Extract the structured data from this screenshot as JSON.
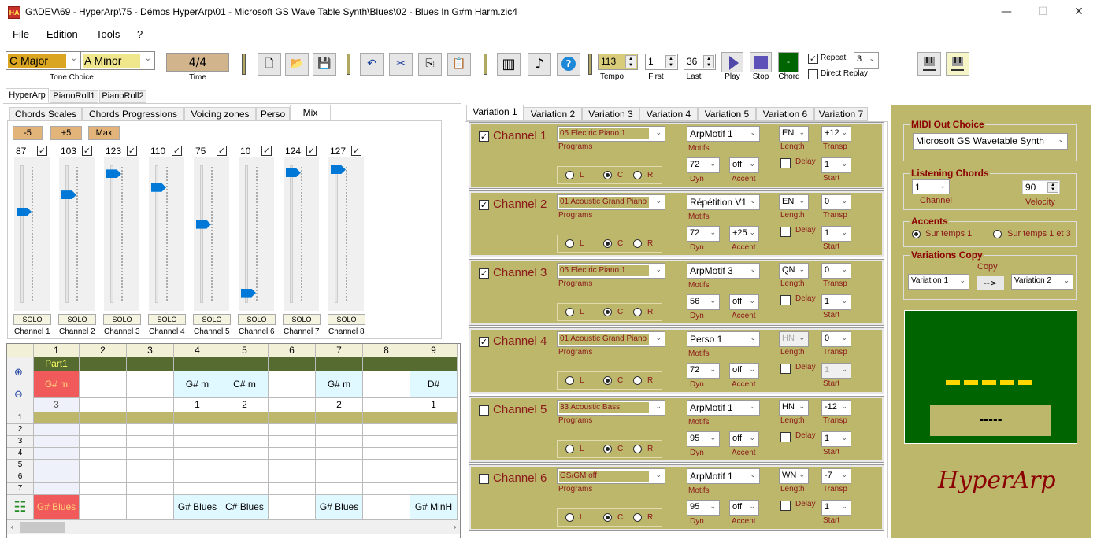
{
  "window": {
    "title": "G:\\DEV\\69 - HyperArp\\75 - Démos HyperArp\\01  - Microsoft GS Wave Table Synth\\Blues\\02 - Blues In G#m Harm.zic4",
    "app_icon": "HA",
    "controls": {
      "minimize": "—",
      "maximize": "☐",
      "close": "✕"
    }
  },
  "menu": [
    "File",
    "Edition",
    "Tools",
    "?"
  ],
  "toolbar": {
    "tone_major": "C Major",
    "tone_minor": "A Minor",
    "tone_label": "Tone Choice",
    "time_value": "4/4",
    "time_label": "Time",
    "icons": {
      "new": "🗋",
      "open": "📂",
      "save": "💾",
      "undo": "↶",
      "cut": "✂",
      "copy": "⎘",
      "paste": "📋",
      "book": "▥",
      "note": "♪",
      "help": "?"
    },
    "tempo": "113",
    "tempo_label": "Tempo",
    "first": "1",
    "first_label": "First",
    "last": "36",
    "last_label": "Last",
    "play_label": "Play",
    "stop_label": "Stop",
    "chord_value": "-",
    "chord_label": "Chord",
    "repeat_label": "Repeat",
    "repeat_checked": true,
    "repeat_count": "3",
    "direct_replay_label": "Direct Replay",
    "direct_replay_checked": false
  },
  "main_tabs": [
    "HyperArp",
    "PianoRoll1",
    "PianoRoll2"
  ],
  "sub_tabs": [
    "Chords Scales",
    "Chords Progressions",
    "Voicing zones",
    "Perso",
    "Mix"
  ],
  "mix": {
    "buttons": [
      "-5",
      "+5",
      "Max"
    ],
    "solo_label": "SOLO",
    "max_volume": 127,
    "channels": [
      {
        "label": "Channel 1",
        "volume": 87,
        "enabled": true
      },
      {
        "label": "Channel 2",
        "volume": 103,
        "enabled": true
      },
      {
        "label": "Channel 3",
        "volume": 123,
        "enabled": true
      },
      {
        "label": "Channel 4",
        "volume": 110,
        "enabled": true
      },
      {
        "label": "Channel 5",
        "volume": 75,
        "enabled": true
      },
      {
        "label": "Channel 6",
        "volume": 10,
        "enabled": true
      },
      {
        "label": "Channel 7",
        "volume": 124,
        "enabled": true
      },
      {
        "label": "Channel 8",
        "volume": 127,
        "enabled": true
      }
    ]
  },
  "grid": {
    "columns": [
      "1",
      "2",
      "3",
      "4",
      "5",
      "6",
      "7",
      "8",
      "9"
    ],
    "part_label": "Part1",
    "chords": [
      "G# m",
      "",
      "",
      "G# m",
      "C# m",
      "",
      "G# m",
      "",
      "D#"
    ],
    "counts": [
      "3",
      "",
      "",
      "1",
      "2",
      "",
      "2",
      "",
      "1"
    ],
    "row_numbers": [
      "1",
      "2",
      "3",
      "4",
      "5",
      "6",
      "7"
    ],
    "scales": [
      "G# Blues",
      "",
      "",
      "G# Blues",
      "C# Blues",
      "",
      "G# Blues",
      "",
      "G# MinH"
    ]
  },
  "variation_tabs": [
    "Variation 1",
    "Variation 2",
    "Variation 3",
    "Variation 4",
    "Variation 5",
    "Variation 6",
    "Variation 7"
  ],
  "channel_labels": {
    "programs": "Programs",
    "motifs": "Motifs",
    "length": "Length",
    "transp": "Transp",
    "dyn": "Dyn",
    "accent": "Accent",
    "delay": "Delay",
    "start": "Start",
    "pan": [
      "L",
      "C",
      "R"
    ]
  },
  "variation_channels": [
    {
      "name": "Channel 1",
      "enabled": true,
      "program": "05 Electric Piano 1",
      "motif": "ArpMotif 1",
      "length": "EN",
      "transp": "+12",
      "dyn": "72",
      "accent": "off",
      "delay": false,
      "start": "1",
      "pan": "C"
    },
    {
      "name": "Channel 2",
      "enabled": true,
      "program": "01 Acoustic Grand Piano",
      "motif": "Répétition V1",
      "length": "EN",
      "transp": "0",
      "dyn": "72",
      "accent": "+25",
      "delay": false,
      "start": "1",
      "pan": "C"
    },
    {
      "name": "Channel 3",
      "enabled": true,
      "program": "05 Electric Piano 1",
      "motif": "ArpMotif 3",
      "length": "QN",
      "transp": "0",
      "dyn": "56",
      "accent": "off",
      "delay": false,
      "start": "1",
      "pan": "C"
    },
    {
      "name": "Channel 4",
      "enabled": true,
      "program": "01 Acoustic Grand Piano",
      "motif": "Perso 1",
      "length": "HN",
      "transp": "0",
      "dyn": "72",
      "accent": "off",
      "delay": false,
      "start": "1",
      "pan": "C",
      "length_disabled": true,
      "start_disabled": true
    },
    {
      "name": "Channel 5",
      "enabled": false,
      "program": "33 Acoustic Bass",
      "motif": "ArpMotif 1",
      "length": "HN",
      "transp": "-12",
      "dyn": "95",
      "accent": "off",
      "delay": false,
      "start": "1",
      "pan": "C"
    },
    {
      "name": "Channel 6",
      "enabled": false,
      "program": "GS/GM off",
      "motif": "ArpMotif 1",
      "length": "WN",
      "transp": "-7",
      "dyn": "95",
      "accent": "off",
      "delay": false,
      "start": "1",
      "pan": "C"
    }
  ],
  "right_panel": {
    "midi_out_title": "MIDI Out Choice",
    "midi_out_value": "Microsoft GS Wavetable Synth",
    "listening_title": "Listening Chords",
    "listening_channel": "1",
    "listening_channel_label": "Channel",
    "velocity": "90",
    "velocity_label": "Velocity",
    "accents_title": "Accents",
    "accent_options": [
      "Sur temps 1",
      "Sur temps 1 et 3"
    ],
    "accent_selected": 0,
    "copy_title": "Variations Copy",
    "copy_label": "Copy",
    "copy_from": "Variation 1",
    "copy_button": "-->",
    "copy_to": "Variation 2",
    "display_text": "-----",
    "logo": "HyperArp"
  },
  "colors": {
    "olive": "#bdb76b",
    "dark_green": "#006400",
    "accent_red": "#8b1a1a",
    "slider_blue": "#0078d7"
  }
}
